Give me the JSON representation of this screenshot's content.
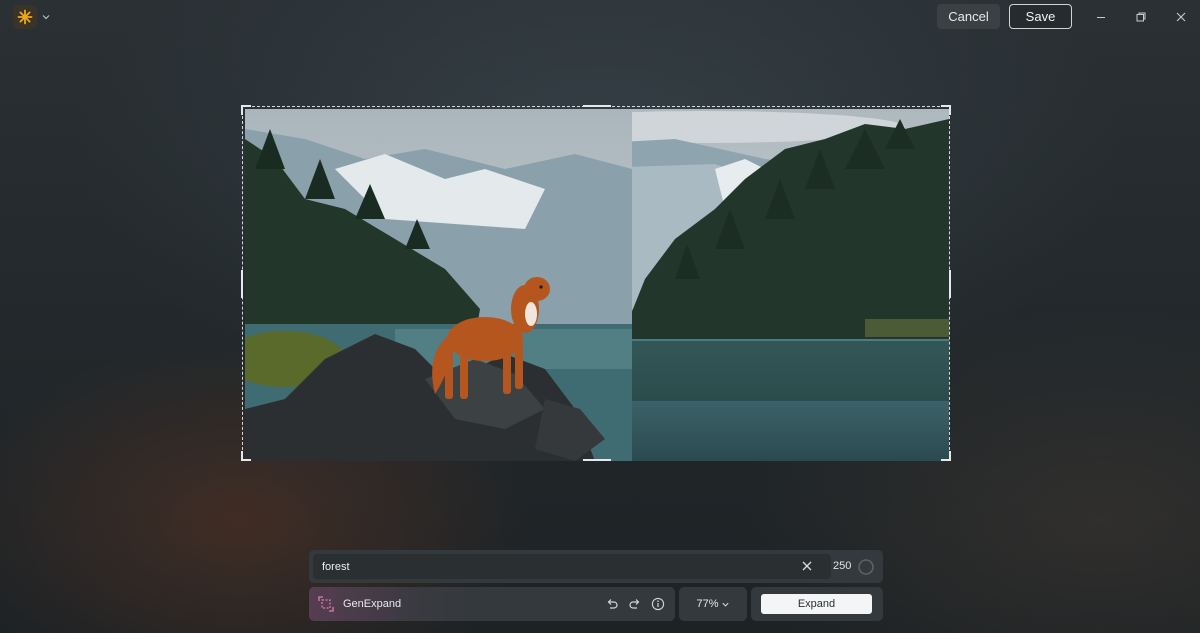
{
  "titlebar": {
    "app_icon": "sparkle-icon",
    "app_menu_icon": "chevron-down-icon",
    "cancel_label": "Cancel",
    "save_label": "Save",
    "window_controls": [
      "minimize-icon",
      "restore-icon",
      "close-icon"
    ]
  },
  "canvas": {
    "photo_description_icon": "image",
    "frame_style": "dashed"
  },
  "prompt": {
    "value": "forest",
    "placeholder": "",
    "clear_icon": "close-icon",
    "char_count": "250",
    "progress_icon": "progress-ring-icon"
  },
  "tool": {
    "icon": "gen-expand-icon",
    "label": "GenExpand",
    "undo_icon": "undo-icon",
    "redo_icon": "redo-icon",
    "info_icon": "info-icon"
  },
  "zoom": {
    "value": "77%",
    "icon": "chevron-down-icon"
  },
  "action": {
    "expand_label": "Expand"
  },
  "colors": {
    "background": "#1f2427",
    "panel": "#33393c",
    "accent_logo": "#f0a818",
    "tool_accent": "#c8478f"
  }
}
